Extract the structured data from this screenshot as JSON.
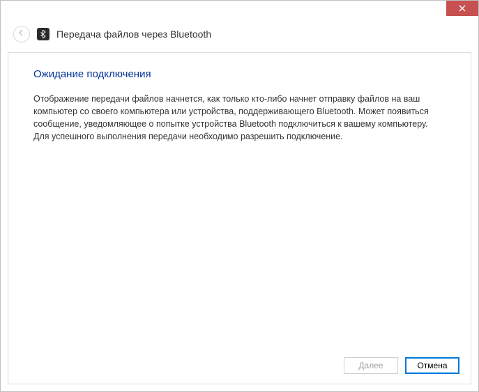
{
  "titlebar": {
    "close_label": "Close"
  },
  "header": {
    "title": "Передача файлов через Bluetooth"
  },
  "content": {
    "subtitle": "Ожидание подключения",
    "body": "Отображение передачи файлов начнется, как только кто-либо начнет отправку файлов на ваш компьютер со своего компьютера или устройства, поддерживающего Bluetooth. Может появиться сообщение, уведомляющее о попытке устройства Bluetooth подключиться к вашему компьютеру. Для успешного выполнения передачи необходимо разрешить подключение."
  },
  "buttons": {
    "next": "Далее",
    "cancel": "Отмена"
  }
}
